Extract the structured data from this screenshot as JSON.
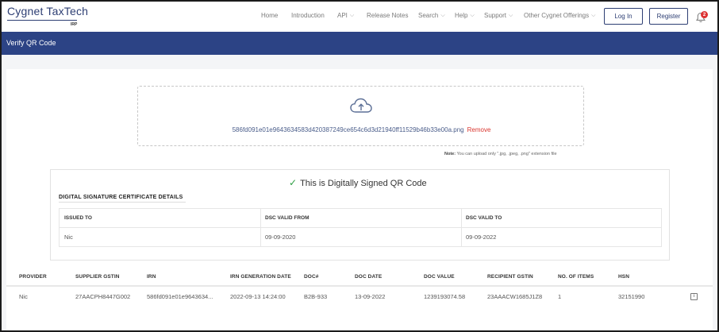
{
  "brand": {
    "name": "Cygnet TaxTech",
    "sub": "IRP"
  },
  "nav": {
    "items": [
      {
        "label": "Home",
        "has_dropdown": false
      },
      {
        "label": "Introduction",
        "has_dropdown": false
      },
      {
        "label": "API",
        "has_dropdown": true
      },
      {
        "label": "Release Notes",
        "has_dropdown": false
      },
      {
        "label": "Search",
        "has_dropdown": true
      },
      {
        "label": "Help",
        "has_dropdown": true
      },
      {
        "label": "Support",
        "has_dropdown": true
      },
      {
        "label": "Other Cygnet Offerings",
        "has_dropdown": true
      }
    ],
    "login_label": "Log In",
    "register_label": "Register",
    "notification_count": "2",
    "chevron": "⌵"
  },
  "page": {
    "title": "Verify QR Code"
  },
  "upload": {
    "file_name": "586fd091e01e9643634583d420387249ce654c6d3d21940ff11529b46b33e00a.png",
    "remove_label": "Remove",
    "note_label": "Note:",
    "note_text": " You can upload only \".jpg, .jpeg, .png\" extension file"
  },
  "verification": {
    "status_text": "This is Digitally Signed QR Code",
    "check_glyph": "✓",
    "section_title": "DIGITAL SIGNATURE CERTIFICATE DETAILS",
    "columns": [
      "ISSUED TO",
      "DSC VALID FROM",
      "DSC VALID TO"
    ],
    "values": [
      "Nic",
      "09-09-2020",
      "09-09-2022"
    ]
  },
  "results_table": {
    "columns": [
      "PROVIDER",
      "SUPPLIER GSTIN",
      "IRN",
      "IRN GENERATION DATE",
      "DOC#",
      "DOC DATE",
      "DOC VALUE",
      "RECIPIENT GSTIN",
      "NO. OF ITEMS",
      "HSN"
    ],
    "rows": [
      [
        "Nic",
        "27AACPH8447G002",
        "586fd091e01e9643634...",
        "2022-09-13 14:24:00",
        "B2B-933",
        "13-09-2022",
        "1239193074.58",
        "23AAACW1685J1Z8",
        "1",
        "32151990"
      ]
    ],
    "info_glyph": "i"
  },
  "colors": {
    "brand": "#2d3e73",
    "titlebar": "#2c4385",
    "remove": "#d9362f",
    "success": "#2f9e44",
    "badge": "#dd3333"
  },
  "icons": [
    "cloud-upload-icon",
    "bell-icon",
    "check-icon",
    "chevron-down-icon",
    "info-icon"
  ]
}
